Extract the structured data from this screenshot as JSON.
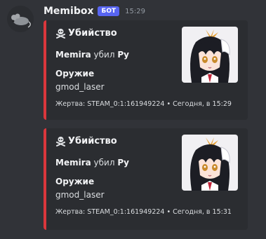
{
  "author": {
    "name": "Memibox",
    "badge": "БОТ",
    "timestamp": "15:29",
    "avatar_icon": "mouse-icon"
  },
  "embed_color": "#da373c",
  "embeds": [
    {
      "title_icon": "skull-crossbones-icon",
      "title": "Убийство",
      "killer": "Memira",
      "verb": " убил ",
      "victim": "Ру",
      "field_name": "Оружие",
      "field_value": "gmod_laser",
      "footer": "Жертва: STEAM_0:1:161949224 • Сегодня, в 15:29",
      "thumbnail_icon": "anime-character-thumbnail"
    },
    {
      "title_icon": "skull-crossbones-icon",
      "title": "Убийство",
      "killer": "Memira",
      "verb": " убил ",
      "victim": "Ру",
      "field_name": "Оружие",
      "field_value": "gmod_laser",
      "footer": "Жертва: STEAM_0:1:161949224 • Сегодня, в 15:31",
      "thumbnail_icon": "anime-character-thumbnail"
    }
  ]
}
